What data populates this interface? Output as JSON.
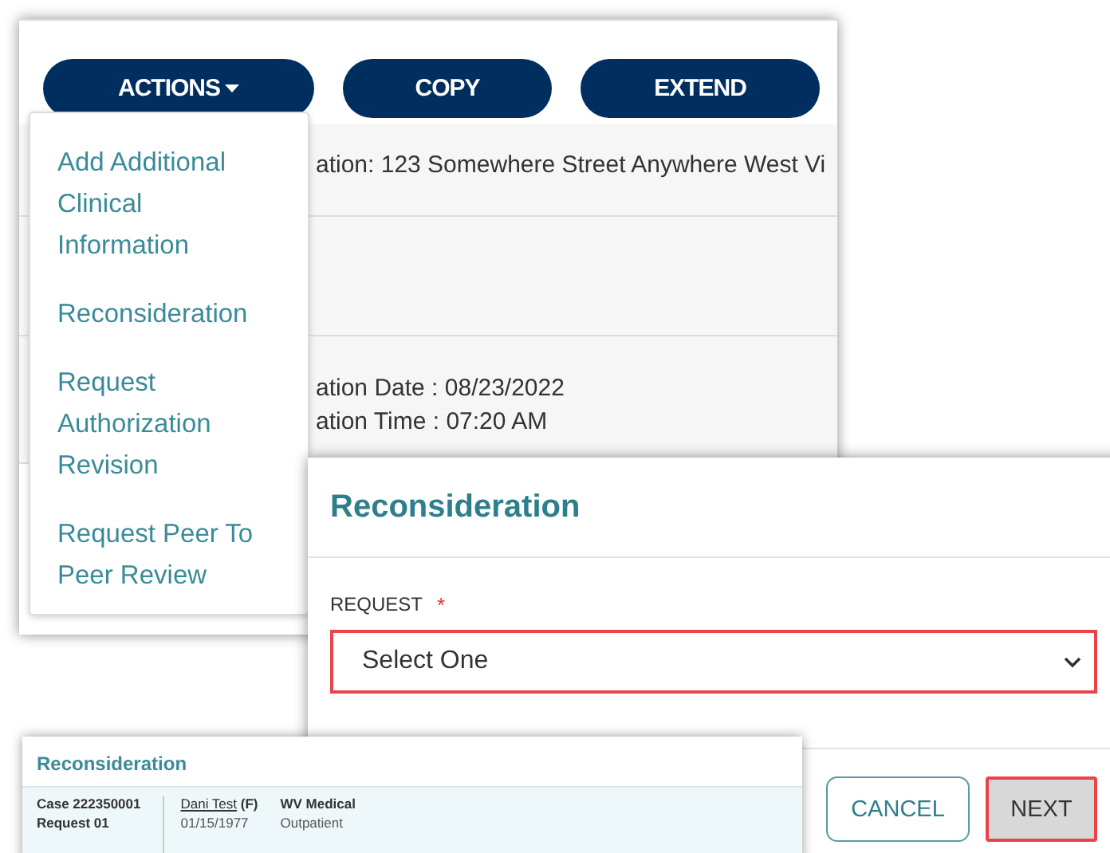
{
  "back_panel": {
    "toolbar": [
      {
        "label": "ACTIONS",
        "kind": "dropdown"
      },
      {
        "label": "COPY",
        "kind": "plain"
      },
      {
        "label": "EXTEND",
        "kind": "plain"
      }
    ],
    "rows": [
      {
        "lines": [
          "ation: 123 Somewhere Street Anywhere West Vi"
        ]
      },
      {
        "lines": [
          "ation Date : 08/23/2022",
          "ation Time : 07:20 AM"
        ]
      }
    ]
  },
  "actions_menu": {
    "items": [
      "Add Additional Clinical Information",
      "Reconsideration",
      "Request Authorization Revision",
      "Request Peer To Peer Review"
    ]
  },
  "dialog": {
    "title": "Reconsideration",
    "field": {
      "label": "REQUEST",
      "required_mark": "*",
      "placeholder": "Select One",
      "highlighted": true
    },
    "buttons": [
      {
        "label": "CANCEL",
        "kind": "outline",
        "highlighted": false
      },
      {
        "label": "NEXT",
        "kind": "primary",
        "highlighted": true
      }
    ]
  },
  "summary_panel": {
    "title": "Reconsideration",
    "case": "Case 222350001",
    "request": "Request 01",
    "member": {
      "name": "Dani Test",
      "sex": "(F)",
      "dob": "01/15/1977"
    },
    "plan": {
      "name": "WV Medical",
      "setting": "Outpatient"
    }
  }
}
